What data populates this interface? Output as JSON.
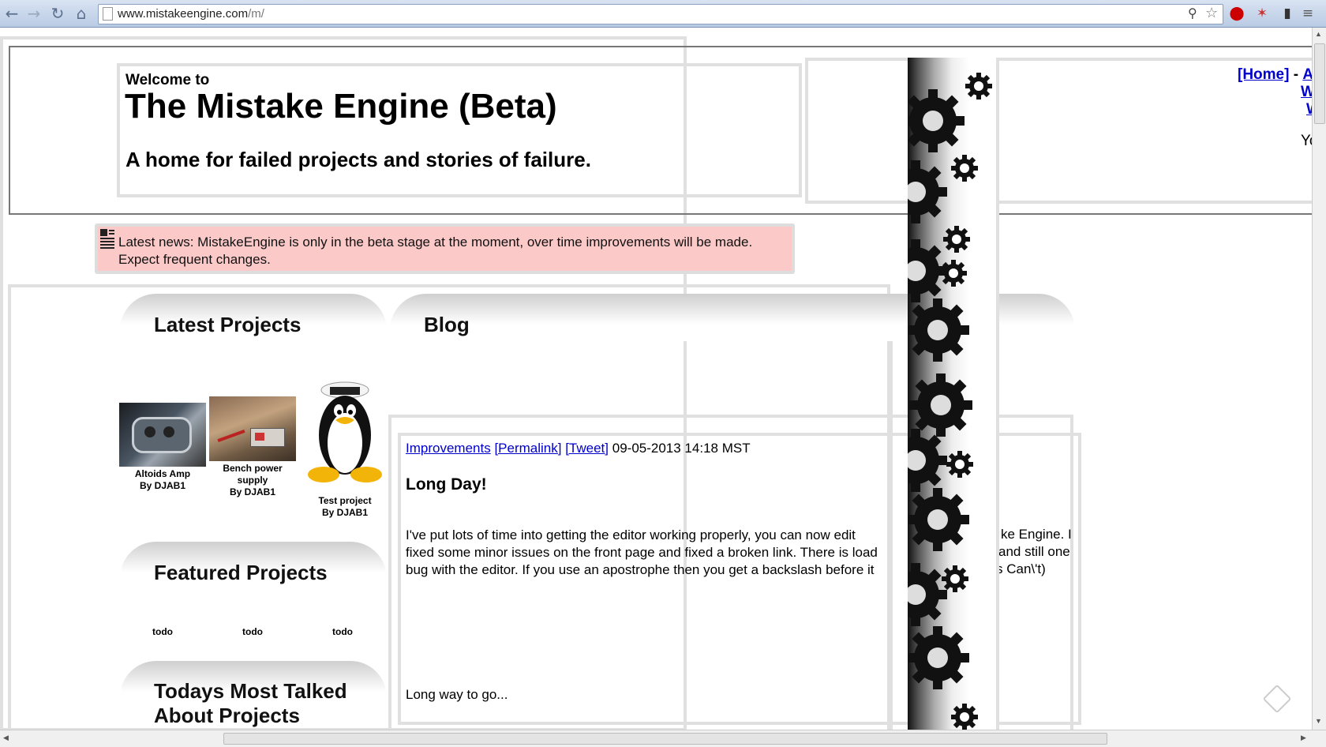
{
  "browser": {
    "url_host": "www.mistakeengine.com",
    "url_path": "/m/",
    "nav": {
      "back_icon": "back-arrow-icon",
      "forward_icon": "forward-arrow-icon",
      "reload_icon": "reload-icon",
      "home_icon": "home-icon"
    }
  },
  "header": {
    "welcome": "Welcome to",
    "title": "The Mistake Engine (Beta)",
    "tagline": "A home for failed projects and stories of failure."
  },
  "right_links": {
    "home": "[Home]",
    "dash": "-",
    "a": "A",
    "w1": "W",
    "w2": "W",
    "yo": "Yo"
  },
  "news": {
    "text": "Latest news: MistakeEngine is only in the beta stage at the moment, over time improvements will be made. Expect frequent changes."
  },
  "sections": {
    "latest_projects": "Latest Projects",
    "blog": "Blog",
    "featured_projects": "Featured Projects",
    "talked_line1": "Todays Most Talked",
    "talked_line2": "About Projects"
  },
  "latest_projects": [
    {
      "title": "Altoids Amp",
      "author": "By DJAB1"
    },
    {
      "title_line1": "Bench power",
      "title_line2": "supply",
      "author": "By DJAB1"
    },
    {
      "title": "Test project",
      "author": "By DJAB1"
    }
  ],
  "featured": [
    "todo",
    "todo",
    "todo"
  ],
  "blog_post": {
    "category": "Improvements",
    "permalink": "[Permalink]",
    "tweet": "[Tweet]",
    "date": "09-05-2013 14:18 MST",
    "title": "Long Day!",
    "line1_a": "I've put lots of time into getting the editor working properly, you can now edit",
    "line1_b": "ke Engine. I",
    "line2_a": "fixed some minor issues on the front page and fixed a broken link. There is load",
    "line2_b": "and still one",
    "line3_a": "bug with the editor. If you use an apostrophe then you get a backslash before it",
    "line3_b": "s Can\\'t)",
    "closing": "Long way to go..."
  }
}
